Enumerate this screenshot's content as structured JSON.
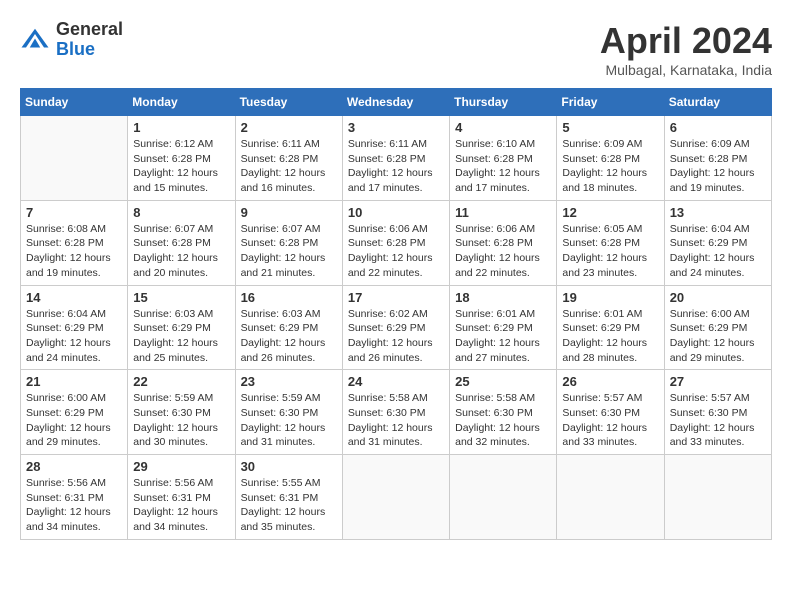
{
  "header": {
    "logo_general": "General",
    "logo_blue": "Blue",
    "month_title": "April 2024",
    "location": "Mulbagal, Karnataka, India"
  },
  "days_of_week": [
    "Sunday",
    "Monday",
    "Tuesday",
    "Wednesday",
    "Thursday",
    "Friday",
    "Saturday"
  ],
  "weeks": [
    [
      {
        "day": null
      },
      {
        "day": 1,
        "sunrise": "6:12 AM",
        "sunset": "6:28 PM",
        "daylight": "12 hours and 15 minutes."
      },
      {
        "day": 2,
        "sunrise": "6:11 AM",
        "sunset": "6:28 PM",
        "daylight": "12 hours and 16 minutes."
      },
      {
        "day": 3,
        "sunrise": "6:11 AM",
        "sunset": "6:28 PM",
        "daylight": "12 hours and 17 minutes."
      },
      {
        "day": 4,
        "sunrise": "6:10 AM",
        "sunset": "6:28 PM",
        "daylight": "12 hours and 17 minutes."
      },
      {
        "day": 5,
        "sunrise": "6:09 AM",
        "sunset": "6:28 PM",
        "daylight": "12 hours and 18 minutes."
      },
      {
        "day": 6,
        "sunrise": "6:09 AM",
        "sunset": "6:28 PM",
        "daylight": "12 hours and 19 minutes."
      }
    ],
    [
      {
        "day": 7,
        "sunrise": "6:08 AM",
        "sunset": "6:28 PM",
        "daylight": "12 hours and 19 minutes."
      },
      {
        "day": 8,
        "sunrise": "6:07 AM",
        "sunset": "6:28 PM",
        "daylight": "12 hours and 20 minutes."
      },
      {
        "day": 9,
        "sunrise": "6:07 AM",
        "sunset": "6:28 PM",
        "daylight": "12 hours and 21 minutes."
      },
      {
        "day": 10,
        "sunrise": "6:06 AM",
        "sunset": "6:28 PM",
        "daylight": "12 hours and 22 minutes."
      },
      {
        "day": 11,
        "sunrise": "6:06 AM",
        "sunset": "6:28 PM",
        "daylight": "12 hours and 22 minutes."
      },
      {
        "day": 12,
        "sunrise": "6:05 AM",
        "sunset": "6:28 PM",
        "daylight": "12 hours and 23 minutes."
      },
      {
        "day": 13,
        "sunrise": "6:04 AM",
        "sunset": "6:29 PM",
        "daylight": "12 hours and 24 minutes."
      }
    ],
    [
      {
        "day": 14,
        "sunrise": "6:04 AM",
        "sunset": "6:29 PM",
        "daylight": "12 hours and 24 minutes."
      },
      {
        "day": 15,
        "sunrise": "6:03 AM",
        "sunset": "6:29 PM",
        "daylight": "12 hours and 25 minutes."
      },
      {
        "day": 16,
        "sunrise": "6:03 AM",
        "sunset": "6:29 PM",
        "daylight": "12 hours and 26 minutes."
      },
      {
        "day": 17,
        "sunrise": "6:02 AM",
        "sunset": "6:29 PM",
        "daylight": "12 hours and 26 minutes."
      },
      {
        "day": 18,
        "sunrise": "6:01 AM",
        "sunset": "6:29 PM",
        "daylight": "12 hours and 27 minutes."
      },
      {
        "day": 19,
        "sunrise": "6:01 AM",
        "sunset": "6:29 PM",
        "daylight": "12 hours and 28 minutes."
      },
      {
        "day": 20,
        "sunrise": "6:00 AM",
        "sunset": "6:29 PM",
        "daylight": "12 hours and 29 minutes."
      }
    ],
    [
      {
        "day": 21,
        "sunrise": "6:00 AM",
        "sunset": "6:29 PM",
        "daylight": "12 hours and 29 minutes."
      },
      {
        "day": 22,
        "sunrise": "5:59 AM",
        "sunset": "6:30 PM",
        "daylight": "12 hours and 30 minutes."
      },
      {
        "day": 23,
        "sunrise": "5:59 AM",
        "sunset": "6:30 PM",
        "daylight": "12 hours and 31 minutes."
      },
      {
        "day": 24,
        "sunrise": "5:58 AM",
        "sunset": "6:30 PM",
        "daylight": "12 hours and 31 minutes."
      },
      {
        "day": 25,
        "sunrise": "5:58 AM",
        "sunset": "6:30 PM",
        "daylight": "12 hours and 32 minutes."
      },
      {
        "day": 26,
        "sunrise": "5:57 AM",
        "sunset": "6:30 PM",
        "daylight": "12 hours and 33 minutes."
      },
      {
        "day": 27,
        "sunrise": "5:57 AM",
        "sunset": "6:30 PM",
        "daylight": "12 hours and 33 minutes."
      }
    ],
    [
      {
        "day": 28,
        "sunrise": "5:56 AM",
        "sunset": "6:31 PM",
        "daylight": "12 hours and 34 minutes."
      },
      {
        "day": 29,
        "sunrise": "5:56 AM",
        "sunset": "6:31 PM",
        "daylight": "12 hours and 34 minutes."
      },
      {
        "day": 30,
        "sunrise": "5:55 AM",
        "sunset": "6:31 PM",
        "daylight": "12 hours and 35 minutes."
      },
      {
        "day": null
      },
      {
        "day": null
      },
      {
        "day": null
      },
      {
        "day": null
      }
    ]
  ]
}
